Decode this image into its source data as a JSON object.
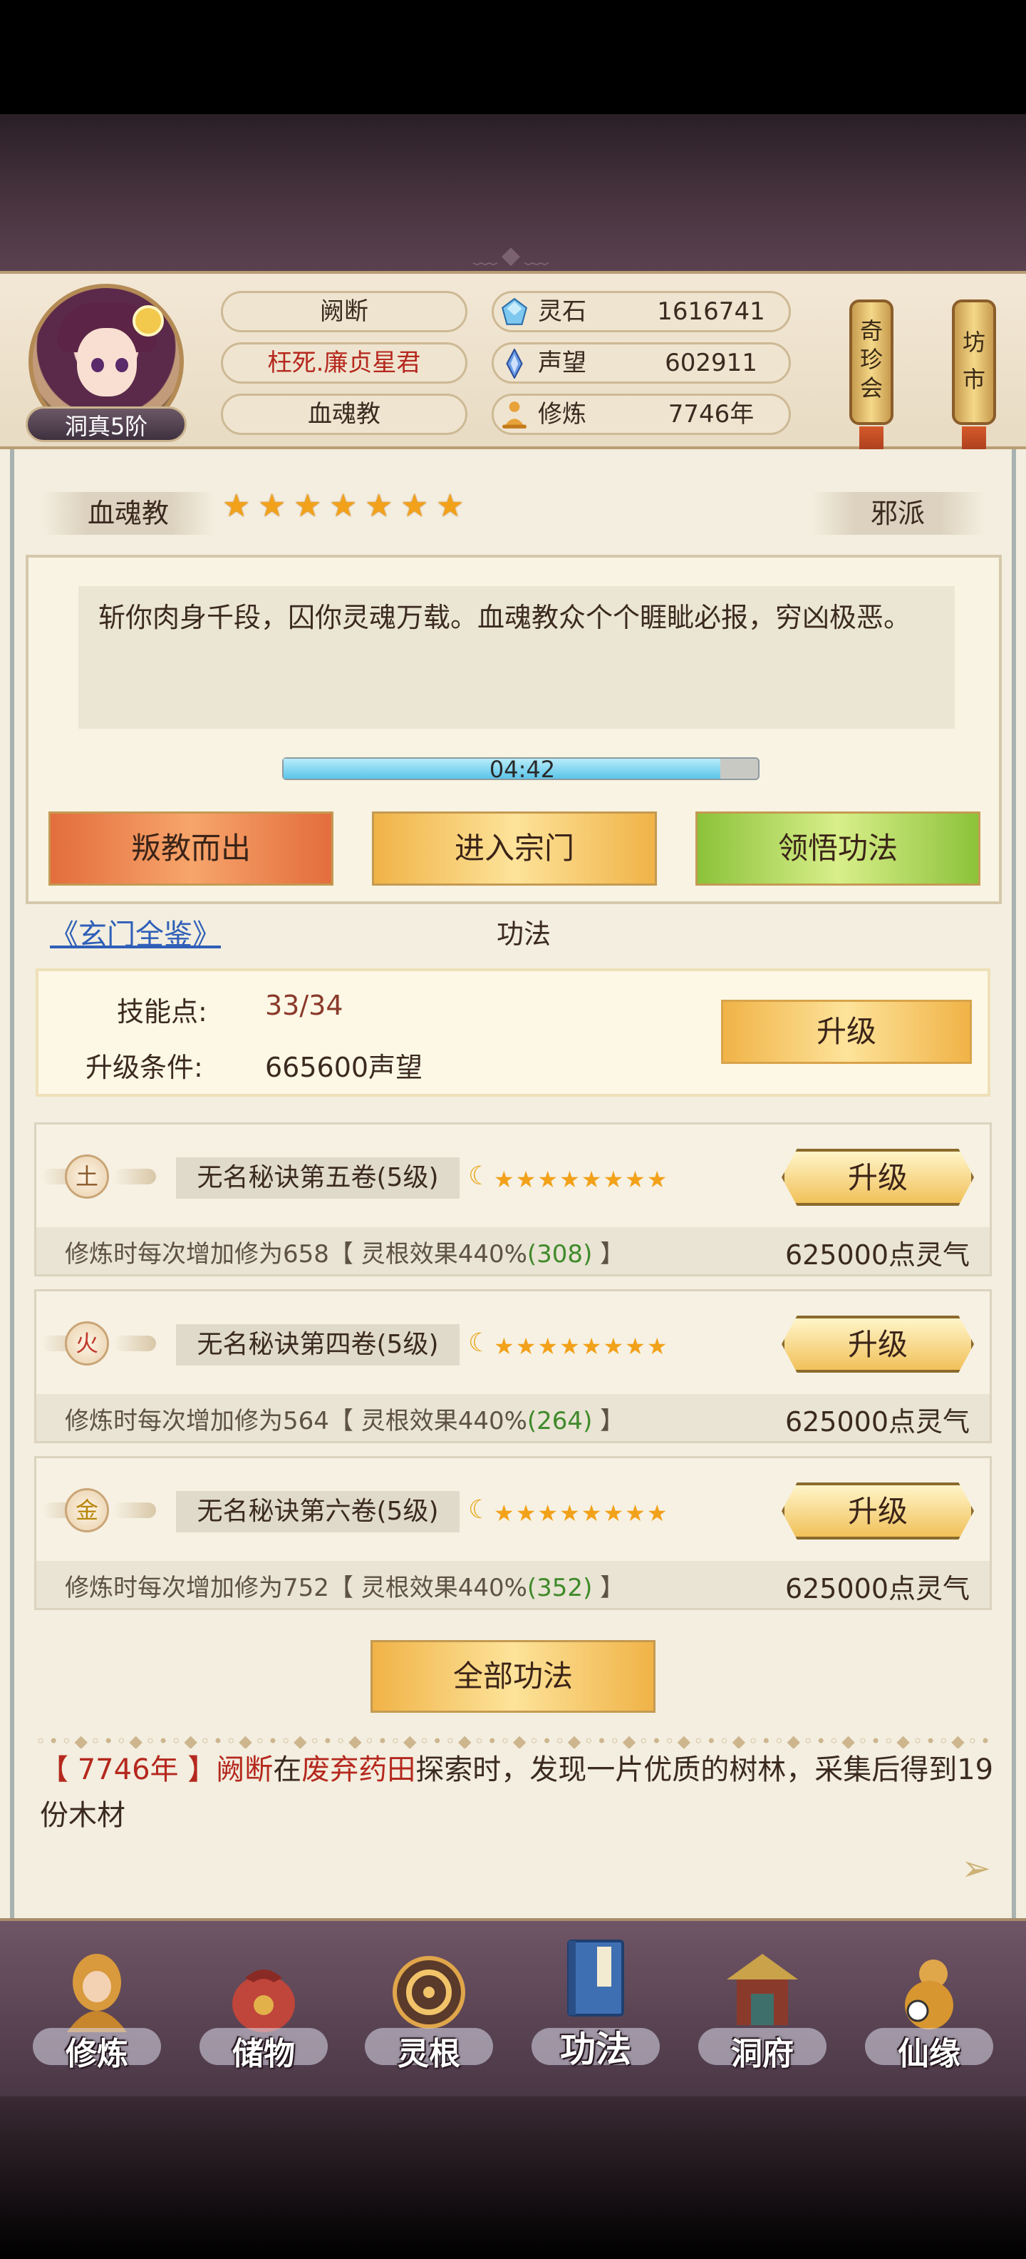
{
  "header": {
    "rank": "洞真5阶",
    "player_name": "阙断",
    "title": "枉死.廉贞星君",
    "sect": "血魂教",
    "resources": [
      {
        "icon": "spirit-stone-icon",
        "label": "灵石",
        "value": "1616741"
      },
      {
        "icon": "prestige-crystal-icon",
        "label": "声望",
        "value": "602911"
      },
      {
        "icon": "meditation-icon",
        "label": "修炼",
        "value": "7746年"
      }
    ],
    "side_scrolls": [
      {
        "name": "treasure-shop",
        "chars": [
          "奇",
          "珍",
          "会"
        ]
      },
      {
        "name": "market",
        "chars": [
          "坊",
          "市"
        ]
      }
    ]
  },
  "sect_panel": {
    "sect_name": "血魂教",
    "stars": 7,
    "alignment": "邪派",
    "description": "斩你肉身千段，囚你灵魂万载。血魂教众个个睚眦必报，穷凶极恶。",
    "timer": "04:42",
    "timer_progress": 0.92,
    "buttons": {
      "leave": "叛教而出",
      "enter": "进入宗门",
      "comprehend": "领悟功法"
    }
  },
  "kungfu": {
    "guide_link": "《玄门全鉴》",
    "section_title": "功法",
    "skill_points_label": "技能点:",
    "skill_points_value": "33/34",
    "upgrade_condition_label": "升级条件:",
    "upgrade_condition_value": "665600声望",
    "upgrade_button": "升级",
    "skills": [
      {
        "element": "土",
        "element_color": "#8a5a2a",
        "name": "无名秘诀第五卷(5级)",
        "stars": "★★★★★★★★",
        "button": "升级",
        "desc_prefix": "修炼时每次增加修为658【 灵根效果440%",
        "desc_bonus": "(308)",
        "desc_suffix": " 】",
        "cost": "625000点灵气"
      },
      {
        "element": "火",
        "element_color": "#c0392b",
        "name": "无名秘诀第四卷(5级)",
        "stars": "★★★★★★★★",
        "button": "升级",
        "desc_prefix": "修炼时每次增加修为564【 灵根效果440%",
        "desc_bonus": "(264)",
        "desc_suffix": " 】",
        "cost": "625000点灵气"
      },
      {
        "element": "金",
        "element_color": "#b8860b",
        "name": "无名秘诀第六卷(5级)",
        "stars": "★★★★★★★★",
        "button": "升级",
        "desc_prefix": "修炼时每次增加修为752【 灵根效果440%",
        "desc_bonus": "(352)",
        "desc_suffix": " 】",
        "cost": "625000点灵气"
      }
    ],
    "all_button": "全部功法"
  },
  "log": {
    "year": "7746年",
    "open_bracket": "【 ",
    "close_bracket": " 】",
    "name": "阙断",
    "in": "在",
    "place": "废弃药田",
    "text": "探索时，发现一片优质的树林，采集后得到19份木材"
  },
  "nav": [
    {
      "name": "cultivate",
      "label": "修炼",
      "icon": "monk-icon"
    },
    {
      "name": "storage",
      "label": "储物",
      "icon": "bag-icon"
    },
    {
      "name": "spirit-root",
      "label": "灵根",
      "icon": "taiji-icon"
    },
    {
      "name": "kungfu",
      "label": "功法",
      "icon": "book-icon",
      "active": true
    },
    {
      "name": "cave",
      "label": "洞府",
      "icon": "pavilion-icon"
    },
    {
      "name": "fortune",
      "label": "仙缘",
      "icon": "gourd-icon"
    }
  ]
}
